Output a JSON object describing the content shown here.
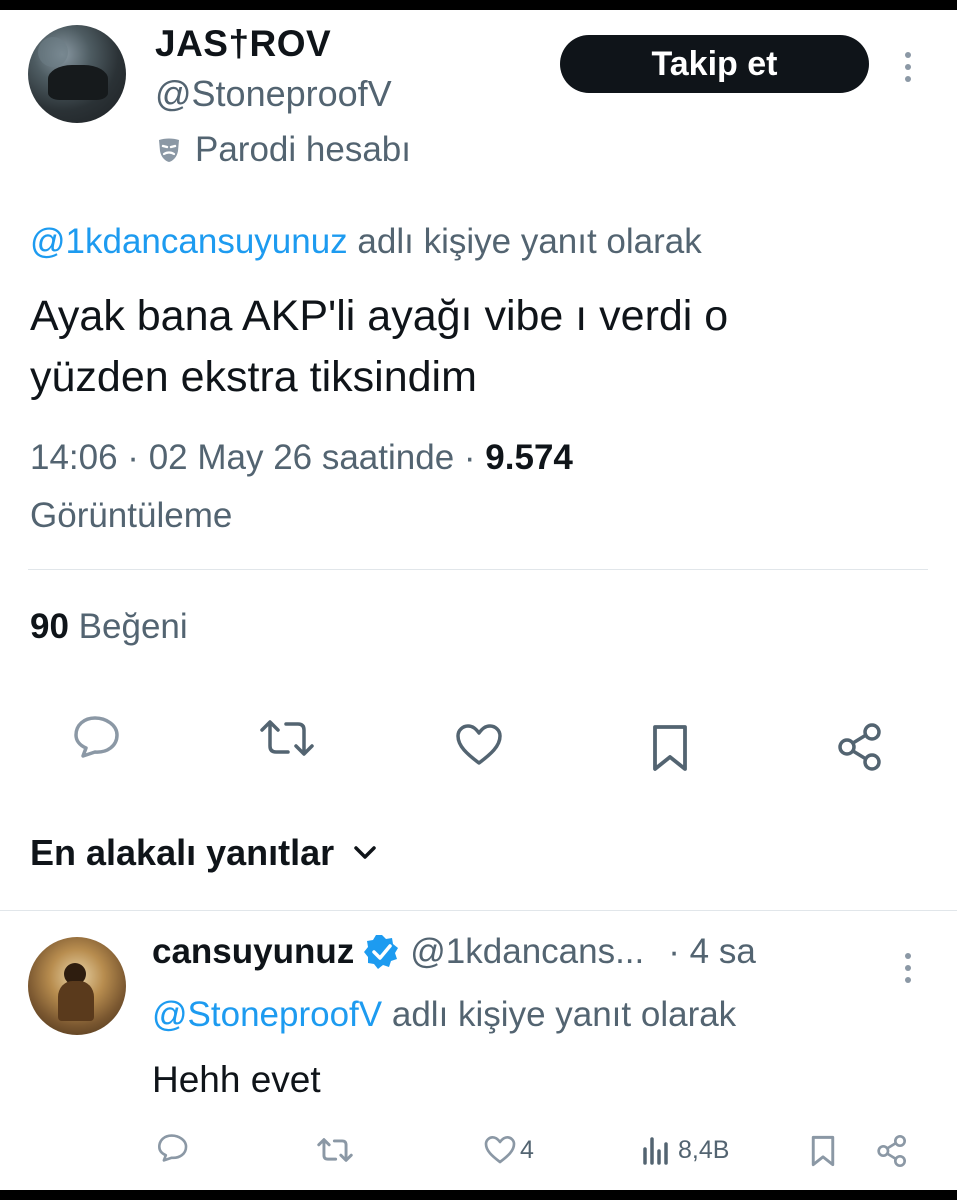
{
  "tweet": {
    "author": {
      "display_name": "JAS†ROV",
      "handle": "@StoneproofV",
      "parody_label": "Parodi hesabı"
    },
    "follow_label": "Takip et",
    "reply_to": {
      "mention": "@1kdancansuyunuz",
      "suffix": "adlı kişiye yanıt olarak"
    },
    "text_line1": "Ayak bana AKP'li ayağı vibe ı verdi o",
    "text_line2": "yüzden ekstra tiksindim",
    "timestamp": "14:06 · 02 May 26 saatinde ·",
    "views_count": "9.574",
    "views_label": "Görüntüleme",
    "likes_count": "90",
    "likes_label": "Beğeni"
  },
  "actions": [
    "reply-icon",
    "retweet-icon",
    "like-icon",
    "bookmark-icon",
    "share-icon"
  ],
  "sort": {
    "label": "En alakalı yanıtlar"
  },
  "reply": {
    "display_name": "cansuyunuz",
    "verified": true,
    "handle": "@1kdancans...",
    "time": "· 4 sa",
    "reply_to_mention": "@StoneproofV",
    "reply_to_suffix": "adlı kişiye yanıt olarak",
    "text": "Hehh evet",
    "like_count": "4",
    "views": "8,4B"
  },
  "colors": {
    "accent": "#1d9bf0",
    "text_primary": "#0f1419",
    "text_secondary": "#536471",
    "follow_button_bg": "#0f1419"
  }
}
